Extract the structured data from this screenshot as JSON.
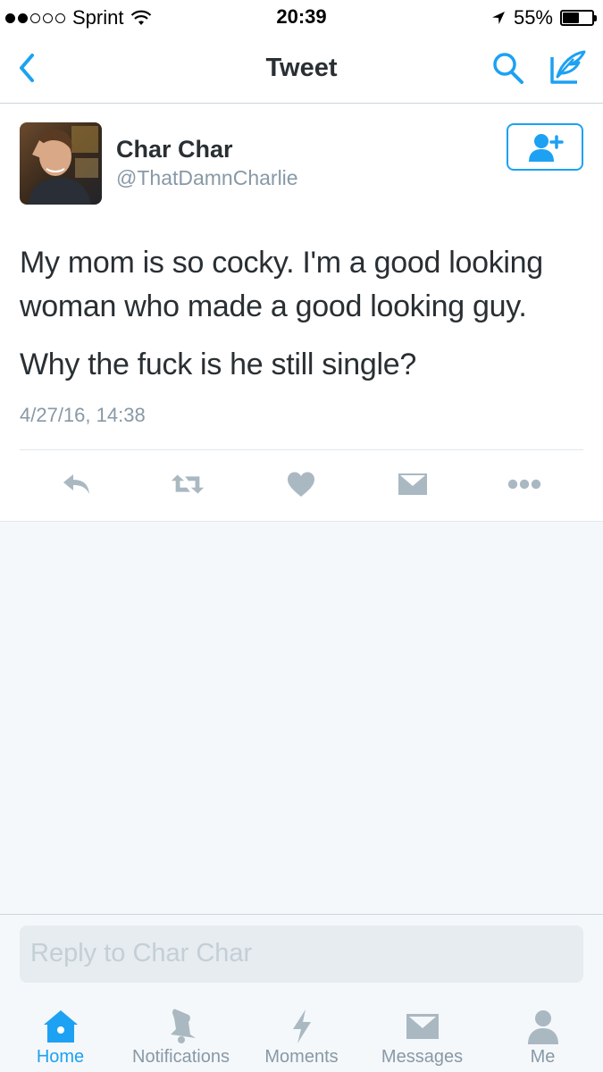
{
  "status_bar": {
    "carrier": "Sprint",
    "time": "20:39",
    "battery_percent": "55%",
    "battery_level": 0.55,
    "signal_bars_filled": 2,
    "signal_bars_total": 5
  },
  "nav": {
    "title": "Tweet",
    "back_icon": "chevron-left-icon",
    "search_icon": "search-icon",
    "compose_icon": "compose-icon"
  },
  "tweet": {
    "display_name": "Char Char",
    "username": "@ThatDamnCharlie",
    "text_paragraph_1": "My mom is so cocky. I'm a good looking woman who made a good looking guy.",
    "text_paragraph_2": "Why the fuck is he still single?",
    "timestamp": "4/27/16, 14:38",
    "follow_icon": "add-user-icon",
    "actions": [
      "reply-icon",
      "retweet-icon",
      "like-icon",
      "direct-message-icon",
      "more-icon"
    ]
  },
  "reply": {
    "placeholder": "Reply to Char Char"
  },
  "tab_bar": {
    "tabs": [
      {
        "label": "Home",
        "icon": "home-icon",
        "active": true
      },
      {
        "label": "Notifications",
        "icon": "bell-icon",
        "active": false
      },
      {
        "label": "Moments",
        "icon": "lightning-icon",
        "active": false
      },
      {
        "label": "Messages",
        "icon": "envelope-icon",
        "active": false
      },
      {
        "label": "Me",
        "icon": "person-icon",
        "active": false
      }
    ]
  },
  "colors": {
    "accent": "#1da1f2",
    "muted": "#8899a6",
    "icon_gray": "#aab8c2",
    "background": "#f5f8fa"
  }
}
